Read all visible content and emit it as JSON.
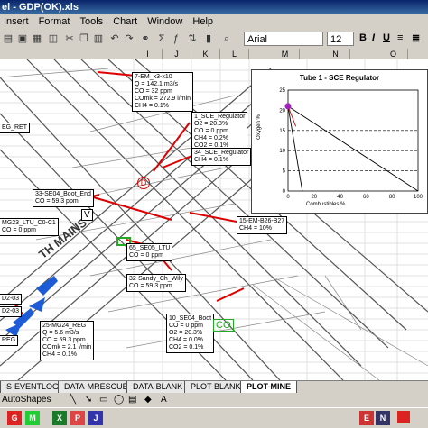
{
  "titlebar": {
    "title": "el - GDP(OK).xls"
  },
  "menu": [
    "Insert",
    "Format",
    "Tools",
    "Chart",
    "Window",
    "Help"
  ],
  "toolbar": {
    "font": "Arial",
    "size": "12"
  },
  "columns": [
    "I",
    "J",
    "K",
    "L",
    "M",
    "N",
    "O"
  ],
  "labels": {
    "l1": [
      "7-EM_x3-x10",
      "Q = 142.1 m3/s",
      "CO = 32 ppm",
      "COmk = 272.9 l/min",
      "CH4 = 0.1%"
    ],
    "l2": [
      "1_SCE_Regulator",
      "O2 = 20.3%",
      "CO = 0 ppm",
      "CH4 = 0.2%",
      "CO2 = 0.1%"
    ],
    "l3": [
      "34_SCE_Regulator",
      "CH4 = 0.1%"
    ],
    "l4": [
      "EG_RET"
    ],
    "l5": [
      "33-SE04_Boot_End",
      "CO = 59.3 ppm"
    ],
    "l6": [
      "MG23_LTU_C0-C1",
      "CO = 0 ppm"
    ],
    "l7": [
      "15-EM-B26-B27",
      "CH4 = 10%"
    ],
    "l8": [
      "65_SE05_LTU",
      "CO = 0 ppm"
    ],
    "l9": [
      "32-Sandy_Ch_Wily",
      "CO = 59.3 ppm"
    ],
    "l10": [
      "D2-03"
    ],
    "l11": [
      "D2-03"
    ],
    "l12": [
      "25-MG24_REG",
      "Q = 5.6 m3/s",
      "CO = 59.3 ppm",
      "COmk = 2.1 l/min",
      "CH4 = 0.1%"
    ],
    "l13": [
      "REG"
    ],
    "l14": [
      "10_SE04_Boot",
      "CO = 0 ppm",
      "O2 = 20.3%",
      "CH4 = 0.0%",
      "CO2 = 0.1%"
    ]
  },
  "map": {
    "mains_text": "TH MAINS",
    "co_marker": "CO",
    "v_marker": "V",
    "d_marker": "D"
  },
  "chart_data": {
    "type": "line",
    "title": "Tube 1 - SCE Regulator",
    "xlabel": "Combustibles %",
    "ylabel": "Oxygen %",
    "xlim": [
      0,
      100
    ],
    "ylim": [
      0,
      25
    ],
    "x_ticks": [
      "0",
      "20",
      "40",
      "60",
      "80",
      "100"
    ],
    "y_ticks": [
      "0",
      "5",
      "10",
      "15",
      "20",
      "25"
    ],
    "series": [
      {
        "x": [
          0,
          100
        ],
        "y": [
          21,
          0
        ]
      },
      {
        "x": [
          0,
          11
        ],
        "y": [
          21,
          0
        ]
      },
      {
        "x": [
          0,
          6
        ],
        "y": [
          21,
          16
        ]
      }
    ],
    "dashed_lines_y": [
      5,
      10,
      15
    ],
    "point": {
      "x": 0,
      "y": 21
    },
    "colors": {
      "point": "#a020c0",
      "lines": "#000000",
      "accent": "#cc0000"
    }
  },
  "tabs": [
    "S-EVENTLOG",
    "DATA-MRESCUE",
    "DATA-BLANK",
    "PLOT-BLANK",
    "PLOT-MINE"
  ],
  "active_tab": "PLOT-MINE",
  "drawbar": {
    "autoshapes": "AutoShapes"
  },
  "taskbar": [
    "G",
    "M",
    "X",
    "P",
    "J",
    "E",
    "N"
  ]
}
